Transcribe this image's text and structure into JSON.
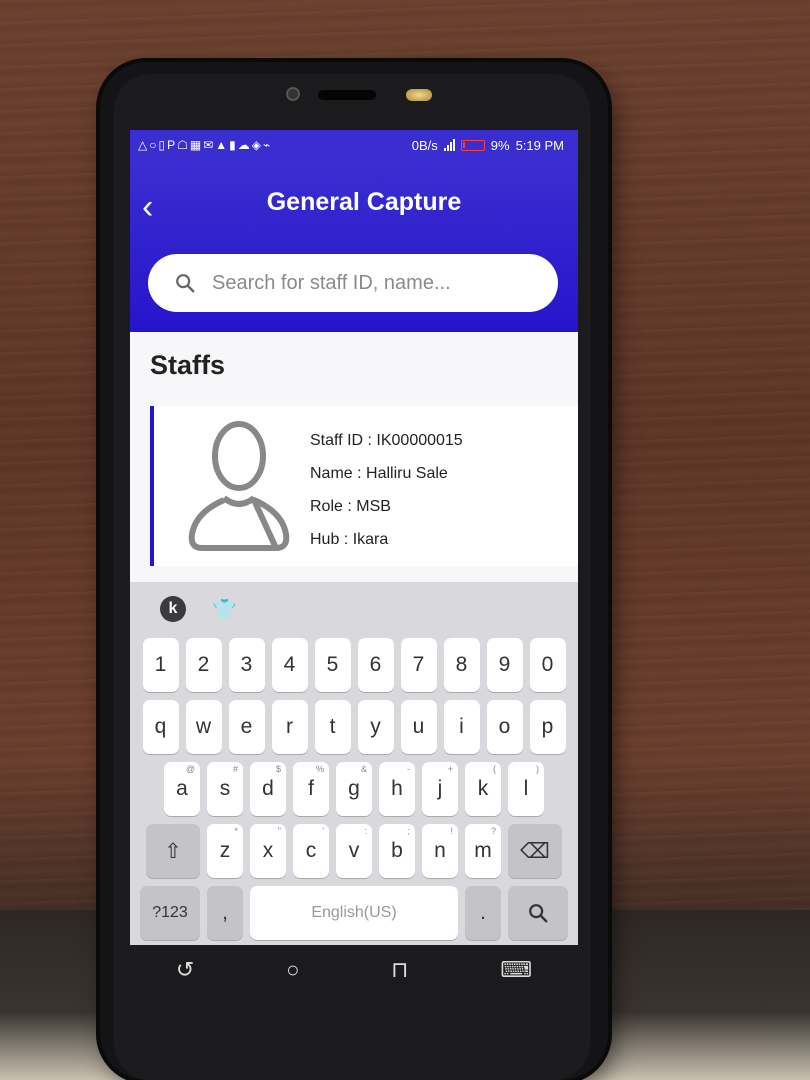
{
  "statusbar": {
    "left_icons": "△○▯P☖▦✉▲▮☁◈⌁",
    "speed": "0B/s",
    "battery": "9%",
    "time": "5:19 PM"
  },
  "header": {
    "title": "General Capture",
    "back_icon": "chevron-left-icon"
  },
  "search": {
    "placeholder": "Search for staff ID, name..."
  },
  "section": {
    "title": "Staffs"
  },
  "staff": {
    "id": "Staff ID : IK00000015",
    "name": "Name : Halliru Sale",
    "role": "Role : MSB",
    "hub": "Hub : Ikara"
  },
  "keyboard": {
    "numbers": [
      "1",
      "2",
      "3",
      "4",
      "5",
      "6",
      "7",
      "8",
      "9",
      "0"
    ],
    "row1": [
      "q",
      "w",
      "e",
      "r",
      "t",
      "y",
      "u",
      "i",
      "o",
      "p"
    ],
    "row2": [
      "a",
      "s",
      "d",
      "f",
      "g",
      "h",
      "j",
      "k",
      "l"
    ],
    "row2_sup": [
      "@",
      "#",
      "$",
      "%",
      "&",
      "-",
      "+",
      "(",
      ")"
    ],
    "row3": [
      "z",
      "x",
      "c",
      "v",
      "b",
      "n",
      "m"
    ],
    "row3_sup": [
      "*",
      "\"",
      "'",
      ":",
      ";",
      "!",
      "?"
    ],
    "symbols_label": "?123",
    "comma": ",",
    "space_label": "English(US)",
    "period": "."
  },
  "colors": {
    "brand": "#2614cc",
    "status_battery": "#ff3b3b"
  }
}
